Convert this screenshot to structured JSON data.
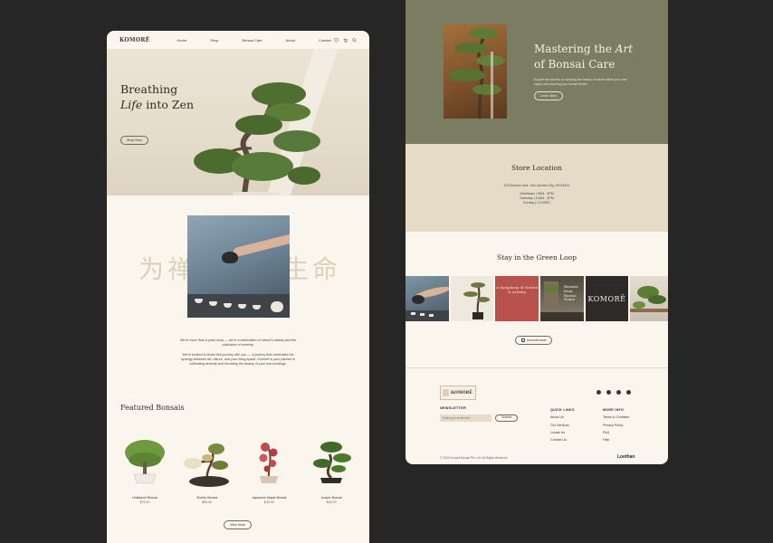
{
  "left": {
    "nav": {
      "logo": "KOMORĒ",
      "links": [
        "Home",
        "Shop",
        "Bonsai Care",
        "About",
        "Contact"
      ],
      "icons": [
        "heart-icon",
        "cart-icon",
        "search-icon"
      ]
    },
    "hero": {
      "title_line1": "Breathing",
      "title_italic": "Life",
      "title_line2_rest": " into Zen",
      "button": "Shop Now"
    },
    "about": {
      "cjk_overlay": "为禅宗注入生命",
      "paragraph1": "We're more than a plant shop — we're a celebration of nature's artistry and the cultivation of serenity.",
      "paragraph2": "We're excited to share this journey with you — a journey that celebrates the synergy between art, nature, and your living space. Komorē is your partner in cultivating serenity and elevating the beauty of your surroundings."
    },
    "featured": {
      "title": "Featured Bonsais",
      "products": [
        {
          "name": "Hokidachi Bonsai",
          "price": "$75.00"
        },
        {
          "name": "Shohin Bonsai",
          "price": "$90.00"
        },
        {
          "name": "Japanese Maple Bonsai",
          "price": "$40.00"
        },
        {
          "name": "Juniper Bonsai",
          "price": "$35.00"
        }
      ],
      "view_more": "View More"
    }
  },
  "right": {
    "mastering": {
      "title_line1_pre": "Mastering the ",
      "title_italic": "Art",
      "title_line2": "of Bonsai Care",
      "description": "Explore the secrets to nurturing the beauty of nature within your own space and ensuring your bonsai thrives.",
      "button": "Learn More"
    },
    "store": {
      "title": "Store Location",
      "address": "123 Bonsai Lane, Zen Garden City, ZN 54321",
      "hours": [
        "Weekdays | 9AM - 6PM",
        "Saturday | 10AM - 3PM",
        "Sunday | CLOSED"
      ]
    },
    "loop": {
      "title": "Stay in the Green Loop",
      "tiles": [
        "A Symphony of Nature & Artistry",
        "Bonsais from Bonsai Home",
        "KOMORĒ"
      ],
      "handle": "komoribonsai"
    },
    "footer": {
      "logo": "KOMORĒ",
      "newsletter_title": "NEWSLETTER",
      "email_placeholder": "Enter your email here",
      "submit": "Submit",
      "socials": [
        "facebook-icon",
        "instagram-icon",
        "google-icon",
        "pinterest-icon"
      ],
      "quick_links_title": "QUICK LINKS",
      "quick_links": [
        "About Us",
        "Our Services",
        "Locate Us",
        "Contact Us"
      ],
      "more_info_title": "MORE INFO",
      "more_info": [
        "Terms & Condition",
        "Privacy Policy",
        "FAQ",
        "Help"
      ],
      "copyright": "© 2023 Komorē Bonsai Pte. Ltd. All Rights Reserved.",
      "brand": "Loethan"
    }
  },
  "colors": {
    "page_bg": "#262626",
    "card_bg": "#faf6ee",
    "olive": "#7a7d62",
    "sand": "#e5dbc6",
    "red_tile": "#b9514d"
  }
}
